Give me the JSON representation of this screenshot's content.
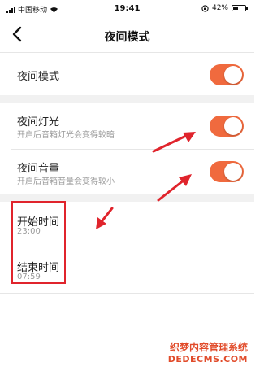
{
  "status_bar": {
    "carrier": "中国移动",
    "time": "19:41",
    "battery_percent": "42%",
    "battery_level": 0.42
  },
  "nav": {
    "back_icon": "chevron-left-icon",
    "title": "夜间模式"
  },
  "settings": {
    "night_mode": {
      "label": "夜间模式",
      "enabled": true
    },
    "night_light": {
      "label": "夜间灯光",
      "description": "开启后音箱灯光会变得较暗",
      "enabled": true
    },
    "night_volume": {
      "label": "夜间音量",
      "description": "开启后音箱音量会变得较小",
      "enabled": true
    },
    "start_time": {
      "label": "开始时间",
      "value": "23:00"
    },
    "end_time": {
      "label": "结束时间",
      "value": "07:59"
    }
  },
  "colors": {
    "toggle_on": "#f06a3e",
    "annotation": "#e0242c"
  },
  "watermark": {
    "line1": "织梦内容管理系统",
    "line2": "DEDECMS.COM"
  }
}
